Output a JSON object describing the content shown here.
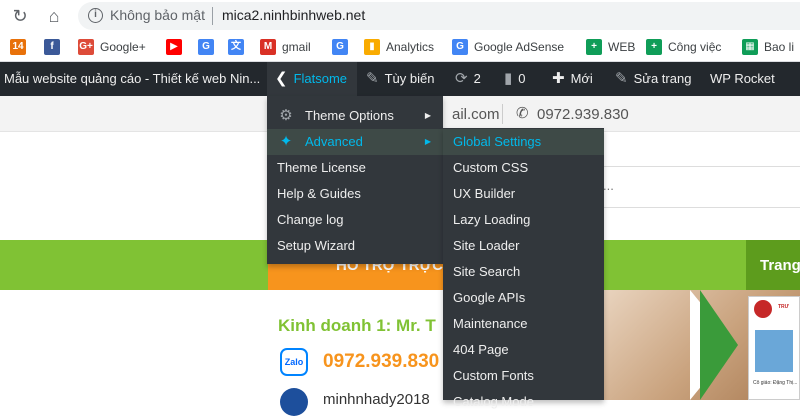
{
  "browser": {
    "security_label": "Không bảo mật",
    "url": "mica2.ninhbinhweb.net"
  },
  "bookmarks": [
    {
      "label": "",
      "icon": "badge-14-icon",
      "badge": "14",
      "color": "#e8710a"
    },
    {
      "label": "",
      "icon": "facebook-icon",
      "badge": "f",
      "color": "#3b5998"
    },
    {
      "label": "Google+",
      "icon": "google-plus-icon",
      "badge": "G+",
      "color": "#dd4b39"
    },
    {
      "label": "",
      "icon": "youtube-icon",
      "badge": "▶",
      "color": "#ff0000"
    },
    {
      "label": "",
      "icon": "google-icon",
      "badge": "G",
      "color": "#4285f4"
    },
    {
      "label": "",
      "icon": "google-translate-icon",
      "badge": "文",
      "color": "#4285f4"
    },
    {
      "label": "gmail",
      "icon": "gmail-icon",
      "badge": "M",
      "color": "#d93025"
    },
    {
      "label": "",
      "icon": "google-icon",
      "badge": "G",
      "color": "#4285f4"
    },
    {
      "label": "Analytics",
      "icon": "analytics-icon",
      "badge": "▮",
      "color": "#f9ab00"
    },
    {
      "label": "Google AdSense",
      "icon": "google-icon",
      "badge": "G",
      "color": "#4285f4"
    },
    {
      "label": "WEB",
      "icon": "sheets-icon",
      "badge": "+",
      "color": "#0f9d58"
    },
    {
      "label": "Công việc",
      "icon": "sheets-icon",
      "badge": "+",
      "color": "#0f9d58"
    },
    {
      "label": "Bao li",
      "icon": "sheets-table-icon",
      "badge": "▦",
      "color": "#0f9d58"
    }
  ],
  "adminbar": {
    "site_name": "Mẫu website quảng cáo - Thiết kế web Nin...",
    "flatsome": "Flatsome",
    "customize": "Tùy biến",
    "updates": "2",
    "comments": "0",
    "new": "Mới",
    "edit_page": "Sửa trang",
    "wp_rocket": "WP Rocket"
  },
  "header": {
    "email_partial": "ail.com",
    "phone": "0972.939.830",
    "search_placeholder": "..."
  },
  "navbar": {
    "support_title": "HỖ TRỢ TRỰC",
    "nav_item": "Trang"
  },
  "content": {
    "business_line": "Kinh doanh 1: Mr. T",
    "zalo_label": "Zalo",
    "phone": "0972.939.830",
    "email_partial": "minhnhady2018"
  },
  "flatsome_menu": [
    {
      "label": "Theme Options",
      "icon": "gear-icon",
      "submenu": true,
      "active": false
    },
    {
      "label": "Advanced",
      "icon": "wrench-icon",
      "submenu": true,
      "active": true
    },
    {
      "label": "Theme License",
      "icon": "",
      "submenu": false,
      "active": false
    },
    {
      "label": "Help & Guides",
      "icon": "",
      "submenu": false,
      "active": false
    },
    {
      "label": "Change log",
      "icon": "",
      "submenu": false,
      "active": false
    },
    {
      "label": "Setup Wizard",
      "icon": "",
      "submenu": false,
      "active": false
    }
  ],
  "advanced_menu": [
    {
      "label": "Global Settings",
      "hover": true
    },
    {
      "label": "Custom CSS",
      "hover": false
    },
    {
      "label": "UX Builder",
      "hover": false
    },
    {
      "label": "Lazy Loading",
      "hover": false
    },
    {
      "label": "Site Loader",
      "hover": false
    },
    {
      "label": "Site Search",
      "hover": false
    },
    {
      "label": "Google APIs",
      "hover": false
    },
    {
      "label": "Maintenance",
      "hover": false
    },
    {
      "label": "404 Page",
      "hover": false
    },
    {
      "label": "Custom Fonts",
      "hover": false
    },
    {
      "label": "Catalog Mode",
      "hover": false
    }
  ],
  "colors": {
    "admin_bar": "#23282d",
    "menu_bg": "#32373c",
    "menu_highlight": "#00b9eb",
    "green": "#80c234",
    "orange": "#f7941d"
  }
}
